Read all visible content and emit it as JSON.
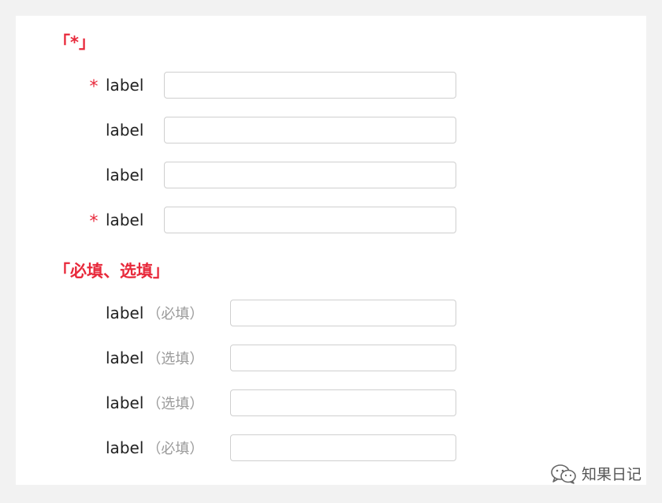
{
  "section1": {
    "title": "「*」",
    "rows": [
      {
        "asterisk": "*",
        "label": "label",
        "value": ""
      },
      {
        "asterisk": "",
        "label": "label",
        "value": ""
      },
      {
        "asterisk": "",
        "label": "label",
        "value": ""
      },
      {
        "asterisk": "*",
        "label": "label",
        "value": ""
      }
    ]
  },
  "section2": {
    "title": "「必填、选填」",
    "rows": [
      {
        "label": "label",
        "hint": "（必填）",
        "value": ""
      },
      {
        "label": "label",
        "hint": "（选填）",
        "value": ""
      },
      {
        "label": "label",
        "hint": "（选填）",
        "value": ""
      },
      {
        "label": "label",
        "hint": "（必填）",
        "value": ""
      }
    ]
  },
  "watermark": {
    "text": "知果日记",
    "icon": "wechat-icon"
  },
  "colors": {
    "accent": "#e8293b",
    "hint": "#9a9a9a",
    "border": "#cfcfcf"
  }
}
